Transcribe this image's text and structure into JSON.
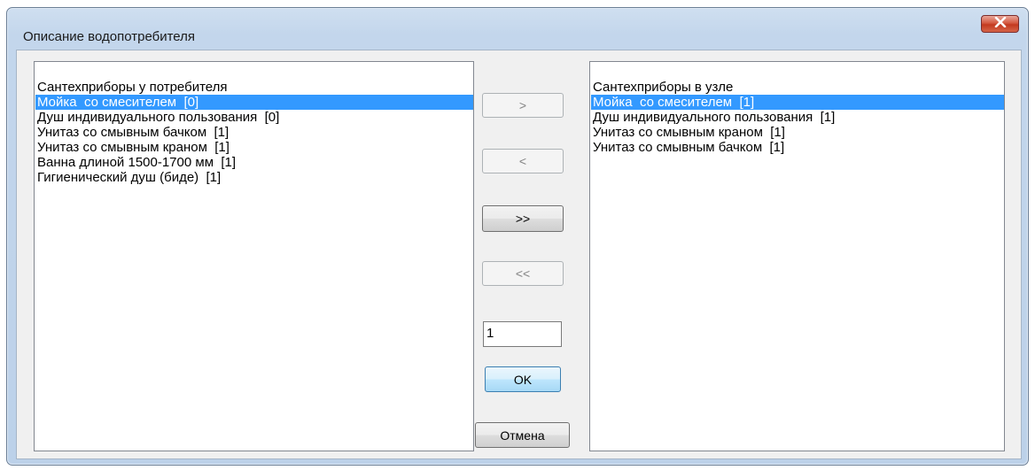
{
  "window": {
    "title": "Описание водопотребителя"
  },
  "left_list": {
    "label": "Сантехприборы у потребителя",
    "items": [
      {
        "label": "Мойка  со смесителем  [0]",
        "selected": true
      },
      {
        "label": "Душ индивидуального пользования  [0]",
        "selected": false
      },
      {
        "label": "Унитаз со смывным бачком  [1]",
        "selected": false
      },
      {
        "label": "Унитаз со смывным краном  [1]",
        "selected": false
      },
      {
        "label": "Ванна длиной 1500-1700 мм  [1]",
        "selected": false
      },
      {
        "label": "Гигиенический душ (биде)  [1]",
        "selected": false
      }
    ]
  },
  "right_list": {
    "label": "Сантехприборы в узле",
    "items": [
      {
        "label": "Мойка  со смесителем  [1]",
        "selected": true
      },
      {
        "label": "Душ индивидуального пользования  [1]",
        "selected": false
      },
      {
        "label": "Унитаз со смывным краном  [1]",
        "selected": false
      },
      {
        "label": "Унитаз со смывным бачком  [1]",
        "selected": false
      }
    ]
  },
  "buttons": {
    "move_right": ">",
    "move_left": "<",
    "move_all_right": ">>",
    "move_all_left": "<<",
    "ok": "OK",
    "cancel": "Отмена"
  },
  "quantity": {
    "value": "1"
  },
  "colors": {
    "selection": "#3399ff",
    "close_button": "#c3391f"
  }
}
